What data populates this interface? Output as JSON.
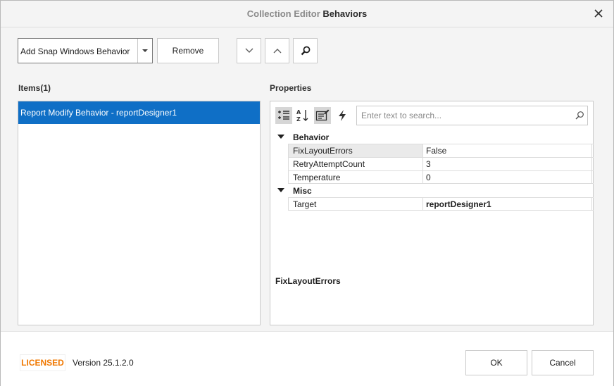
{
  "window": {
    "title_prefix": "Collection Editor",
    "title_main": "Behaviors",
    "close_icon": "close-icon"
  },
  "toolbar": {
    "add_combo_value": "Add Snap Windows Behavior",
    "remove_label": "Remove",
    "move_down_icon": "chevron-down-icon",
    "move_up_icon": "chevron-up-icon",
    "search_icon": "search-icon"
  },
  "items": {
    "header": "Items(1)",
    "list": [
      {
        "label": "Report Modify Behavior - reportDesigner1",
        "selected": true
      }
    ]
  },
  "properties": {
    "header": "Properties",
    "search_placeholder": "Enter text to search...",
    "tool_icons": [
      "categorized-icon",
      "alphabetical-icon",
      "properties-icon",
      "events-icon"
    ],
    "categories": [
      {
        "name": "Behavior",
        "rows": [
          {
            "name": "FixLayoutErrors",
            "value": "False",
            "selected": true,
            "bold": false
          },
          {
            "name": "RetryAttemptCount",
            "value": "3",
            "selected": false,
            "bold": false
          },
          {
            "name": "Temperature",
            "value": "0",
            "selected": false,
            "bold": false
          }
        ]
      },
      {
        "name": "Misc",
        "rows": [
          {
            "name": "Target",
            "value": "reportDesigner1",
            "selected": false,
            "bold": true
          }
        ]
      }
    ],
    "description_title": "FixLayoutErrors"
  },
  "footer": {
    "licensed_badge": "LICENSED",
    "version": "Version 25.1.2.0",
    "ok_label": "OK",
    "cancel_label": "Cancel"
  },
  "colors": {
    "accent": "#0f6fc6",
    "licensed": "#f07800"
  }
}
